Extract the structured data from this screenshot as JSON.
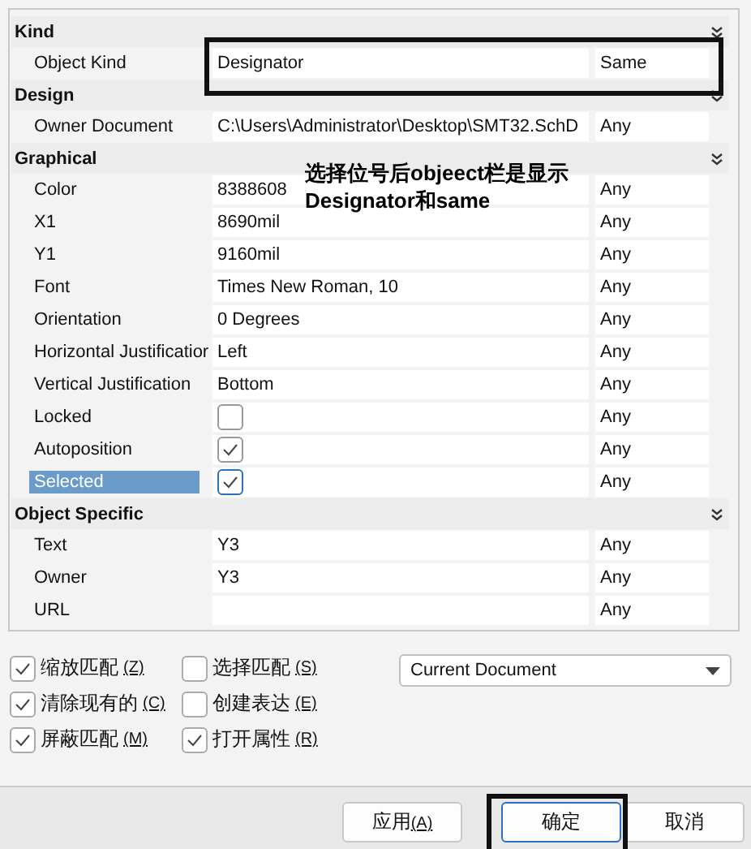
{
  "sections": [
    {
      "title": "Kind",
      "rows": [
        {
          "name": "Object Kind",
          "kind": "text",
          "value": "Designator",
          "match": "Same",
          "selected": false
        }
      ]
    },
    {
      "title": "Design",
      "rows": [
        {
          "name": "Owner Document",
          "kind": "text",
          "value": "C:\\Users\\Administrator\\Desktop\\SMT32.SchD",
          "match": "Any",
          "selected": false
        }
      ]
    },
    {
      "title": "Graphical",
      "rows": [
        {
          "name": "Color",
          "kind": "text",
          "value": "8388608",
          "match": "Any",
          "selected": false
        },
        {
          "name": "X1",
          "kind": "text",
          "value": "8690mil",
          "match": "Any",
          "selected": false
        },
        {
          "name": "Y1",
          "kind": "text",
          "value": "9160mil",
          "match": "Any",
          "selected": false
        },
        {
          "name": "Font",
          "kind": "text",
          "value": "Times New Roman, 10",
          "match": "Any",
          "selected": false
        },
        {
          "name": "Orientation",
          "kind": "text",
          "value": "0 Degrees",
          "match": "Any",
          "selected": false
        },
        {
          "name": "Horizontal Justificatior",
          "kind": "text",
          "value": "Left",
          "match": "Any",
          "selected": false
        },
        {
          "name": "Vertical Justification",
          "kind": "text",
          "value": "Bottom",
          "match": "Any",
          "selected": false
        },
        {
          "name": "Locked",
          "kind": "checkbox",
          "checked": false,
          "match": "Any",
          "selected": false
        },
        {
          "name": "Autoposition",
          "kind": "checkbox",
          "checked": true,
          "match": "Any",
          "selected": false
        },
        {
          "name": "Selected",
          "kind": "checkbox",
          "checked": true,
          "match": "Any",
          "selected": true
        }
      ]
    },
    {
      "title": "Object Specific",
      "rows": [
        {
          "name": "Text",
          "kind": "text",
          "value": "Y3",
          "match": "Any",
          "selected": false
        },
        {
          "name": "Owner",
          "kind": "text",
          "value": "Y3",
          "match": "Any",
          "selected": false
        },
        {
          "name": "URL",
          "kind": "text",
          "value": "",
          "match": "Any",
          "selected": false
        }
      ]
    }
  ],
  "annotation": "选择位号后objeect栏是显示Designator和same",
  "options": [
    {
      "label": "缩放匹配",
      "key": "(Z)",
      "checked": true
    },
    {
      "label": "选择匹配",
      "key": "(S)",
      "checked": false
    },
    {
      "label": "清除现有的",
      "key": "(C)",
      "checked": true
    },
    {
      "label": "创建表达",
      "key": "(E)",
      "checked": false
    },
    {
      "label": "屏蔽匹配",
      "key": "(M)",
      "checked": true
    },
    {
      "label": "打开属性",
      "key": "(R)",
      "checked": true
    }
  ],
  "scope": {
    "value": "Current Document"
  },
  "buttons": [
    {
      "label": "应用",
      "key": "(A)",
      "focused": false
    },
    {
      "label": "确定",
      "focused": true
    },
    {
      "label": "取消",
      "focused": false
    }
  ]
}
